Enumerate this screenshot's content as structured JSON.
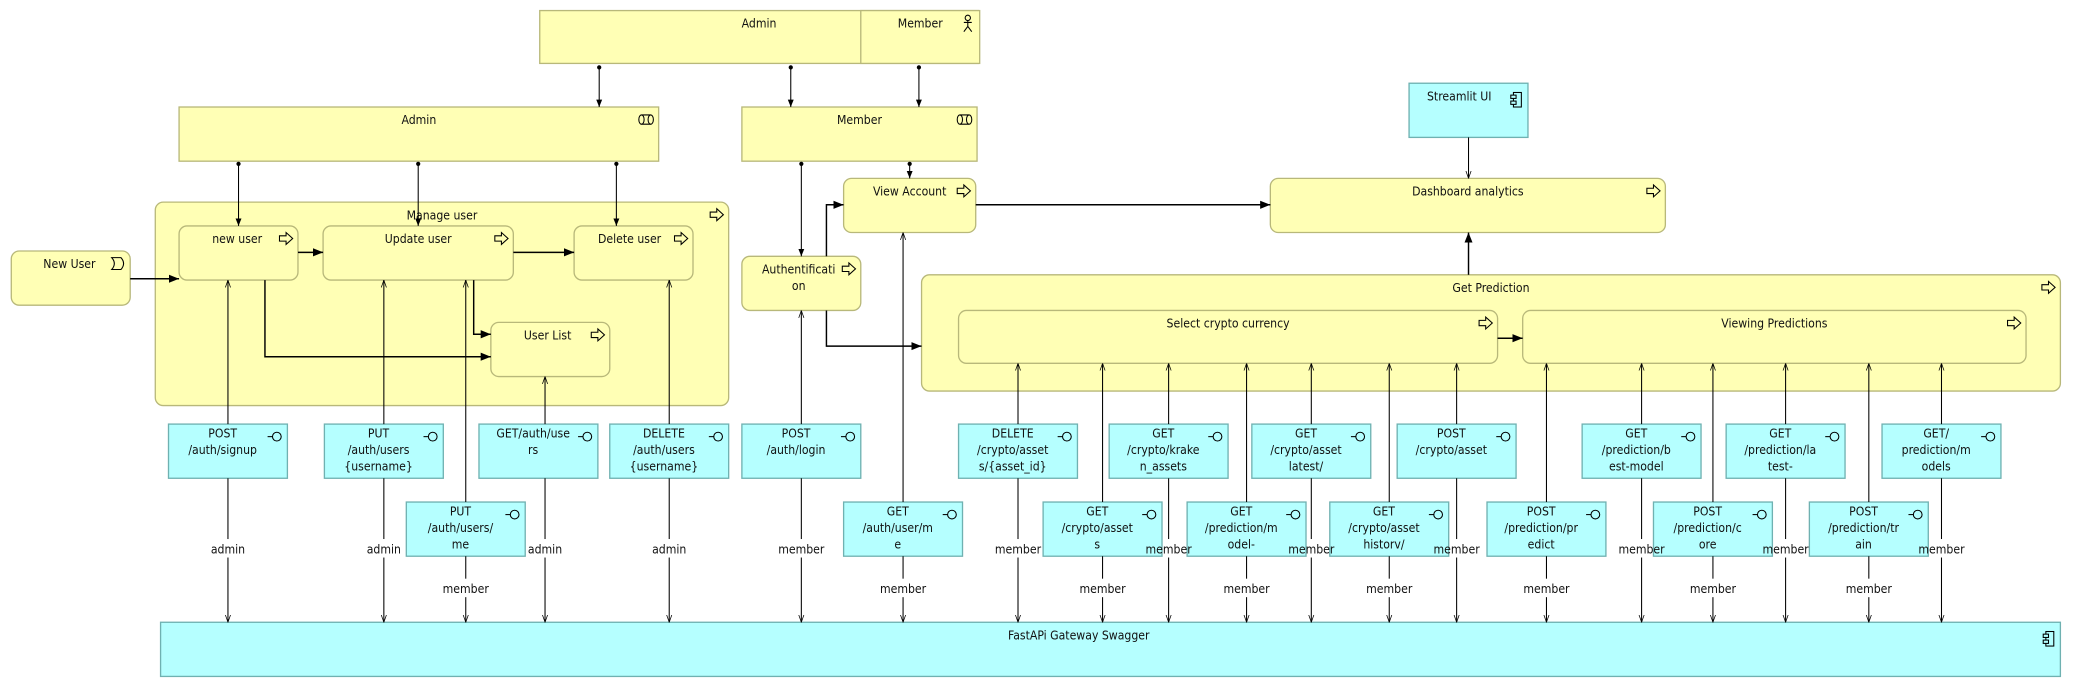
{
  "diagram": {
    "actors": [
      {
        "label": "Admin"
      },
      {
        "label": "Member"
      }
    ],
    "roles": [
      {
        "label": "Admin"
      },
      {
        "label": "Member"
      }
    ],
    "event": {
      "label": "New User"
    },
    "processes": {
      "manage_user": "Manage user",
      "new_user": "new user",
      "update_user": "Update user",
      "delete_user": "Delete user",
      "user_list": "User List",
      "view_account": "View Account",
      "authentification": [
        "Authentificati",
        "on"
      ],
      "dashboard": "Dashboard analytics",
      "get_prediction": "Get Prediction",
      "select_crypto": "Select crypto currency",
      "viewing_predictions": "Viewing Predictions"
    },
    "components": {
      "streamlit": "Streamlit UI",
      "gateway": "FastAPi  Gateway Swagger"
    },
    "interfaces": [
      {
        "lines": [
          "POST",
          "/auth/signup"
        ],
        "access": "admin"
      },
      {
        "lines": [
          "PUT",
          "/auth/users",
          "{username}"
        ],
        "access": "admin"
      },
      {
        "lines": [
          "PUT",
          "/auth/users/",
          "me"
        ],
        "access": "member"
      },
      {
        "lines": [
          "GET/auth/use",
          "rs"
        ],
        "access": "admin"
      },
      {
        "lines": [
          "DELETE",
          "/auth/users",
          "{username}"
        ],
        "access": "admin"
      },
      {
        "lines": [
          "POST",
          "/auth/login"
        ],
        "access": "member"
      },
      {
        "lines": [
          "GET",
          "/auth/user/m",
          "e"
        ],
        "access": "member"
      },
      {
        "lines": [
          "DELETE",
          "/crypto/asset",
          "s/{asset_id}"
        ],
        "access": "member"
      },
      {
        "lines": [
          "GET",
          "/crypto/asset",
          "s"
        ],
        "access": "member"
      },
      {
        "lines": [
          "GET",
          "/crypto/krake",
          "n_assets"
        ],
        "access": "member"
      },
      {
        "lines": [
          "GET",
          "/prediction/m",
          "odel-"
        ],
        "access": "member"
      },
      {
        "lines": [
          "GET",
          "/crypto/asset",
          "latest/"
        ],
        "access": "member"
      },
      {
        "lines": [
          "GET",
          "/crypto/asset",
          "historv/"
        ],
        "access": "member"
      },
      {
        "lines": [
          "POST",
          "/crypto/asset"
        ],
        "access": "member"
      },
      {
        "lines": [
          "POST",
          "/prediction/pr",
          "edict"
        ],
        "access": "member"
      },
      {
        "lines": [
          "GET",
          "/prediction/b",
          "est-model"
        ],
        "access": "member"
      },
      {
        "lines": [
          "POST",
          "/prediction/c",
          "ore"
        ],
        "access": "member"
      },
      {
        "lines": [
          "GET",
          "/prediction/la",
          "test-"
        ],
        "access": "member"
      },
      {
        "lines": [
          "POST",
          "/prediction/tr",
          "ain"
        ],
        "access": "member"
      },
      {
        "lines": [
          "GET/",
          "prediction/m",
          "odels"
        ],
        "access": "member"
      }
    ],
    "colors": {
      "business_fill": "#ffffb5",
      "business_stroke": "#b8b87a",
      "application_fill": "#b5ffff",
      "application_stroke": "#6fb1b1"
    }
  }
}
